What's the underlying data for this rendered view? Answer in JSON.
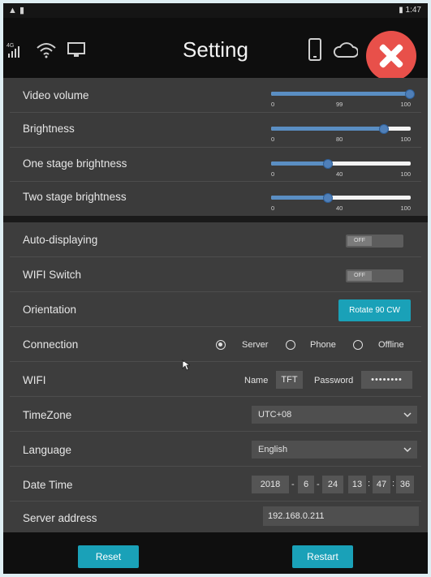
{
  "status_bar": {
    "time": "1:47"
  },
  "header": {
    "title": "Setting",
    "left_icons": [
      "4g-signal-icon",
      "wifi-icon",
      "monitor-icon"
    ],
    "right_icons": [
      "phone-icon",
      "cloud-icon",
      "close-icon"
    ]
  },
  "sliders": [
    {
      "label": "Video volume",
      "min": "0",
      "mid": "99",
      "max": "100",
      "value": 99
    },
    {
      "label": "Brightness",
      "min": "0",
      "mid": "80",
      "max": "100",
      "value": 80
    },
    {
      "label": "One stage brightness",
      "min": "0",
      "mid": "40",
      "max": "100",
      "value": 40
    },
    {
      "label": "Two stage brightness",
      "min": "0",
      "mid": "40",
      "max": "100",
      "value": 40
    }
  ],
  "settings": {
    "auto_displaying": {
      "label": "Auto-displaying",
      "state": "OFF"
    },
    "wifi_switch": {
      "label": "WIFI Switch",
      "state": "OFF"
    },
    "orientation": {
      "label": "Orientation",
      "button": "Rotate 90 CW"
    },
    "connection": {
      "label": "Connection",
      "options": [
        "Server",
        "Phone",
        "Offline"
      ],
      "selected": "Server"
    },
    "wifi": {
      "label": "WIFI",
      "name_label": "Name",
      "name_value": "TFT",
      "password_label": "Password",
      "password_value": "••••••••"
    },
    "timezone": {
      "label": "TimeZone",
      "value": "UTC+08"
    },
    "language": {
      "label": "Language",
      "value": "English"
    },
    "datetime": {
      "label": "Date Time",
      "year": "2018",
      "month": "6",
      "day": "24",
      "hour": "13",
      "minute": "47",
      "second": "36",
      "sep_date": "-",
      "sep_time": ":"
    },
    "server_address": {
      "label": "Server address",
      "value": "192.168.0.211"
    }
  },
  "footer": {
    "reset": "Reset",
    "restart": "Restart"
  },
  "colors": {
    "accent": "#1aa1b8",
    "close": "#e8504a",
    "slider": "#5a8ec3"
  }
}
